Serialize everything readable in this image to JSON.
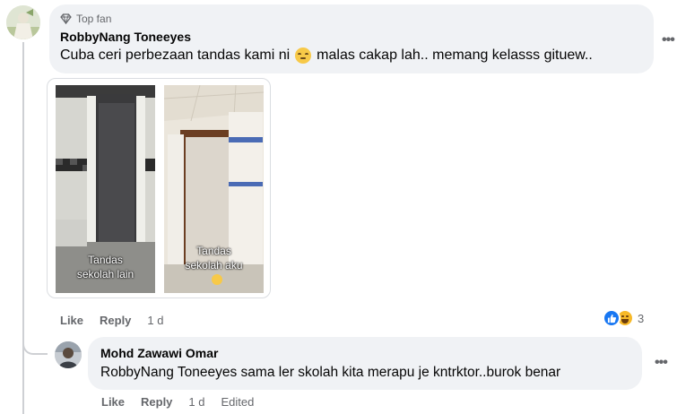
{
  "comment": {
    "badge": "Top fan",
    "author": "RobbyNang Toneeyes",
    "text_before_emoji": "Cuba ceri perbezaan tandas kami ni",
    "text_after_emoji": "malas cakap lah.. memang kelasss gituew..",
    "photos": [
      {
        "caption_line1": "Tandas",
        "caption_line2": "sekolah lain"
      },
      {
        "caption_line1": "Tandas",
        "caption_line2": "sekolah aku"
      }
    ],
    "actions": {
      "like": "Like",
      "reply": "Reply",
      "time": "1 d"
    },
    "reaction_count": "3",
    "more": "•••"
  },
  "reply": {
    "author": "Mohd Zawawi Omar",
    "text": "RobbyNang Toneeyes sama ler skolah kita merapu je kntrktor..burok benar",
    "actions": {
      "like": "Like",
      "reply": "Reply",
      "time": "1 d",
      "edited": "Edited"
    },
    "more": "•••"
  },
  "colors": {
    "bubble": "#f0f2f5",
    "meta": "#65676b",
    "like_blue": "#1877f2",
    "haha_yellow": "#f7b928"
  }
}
